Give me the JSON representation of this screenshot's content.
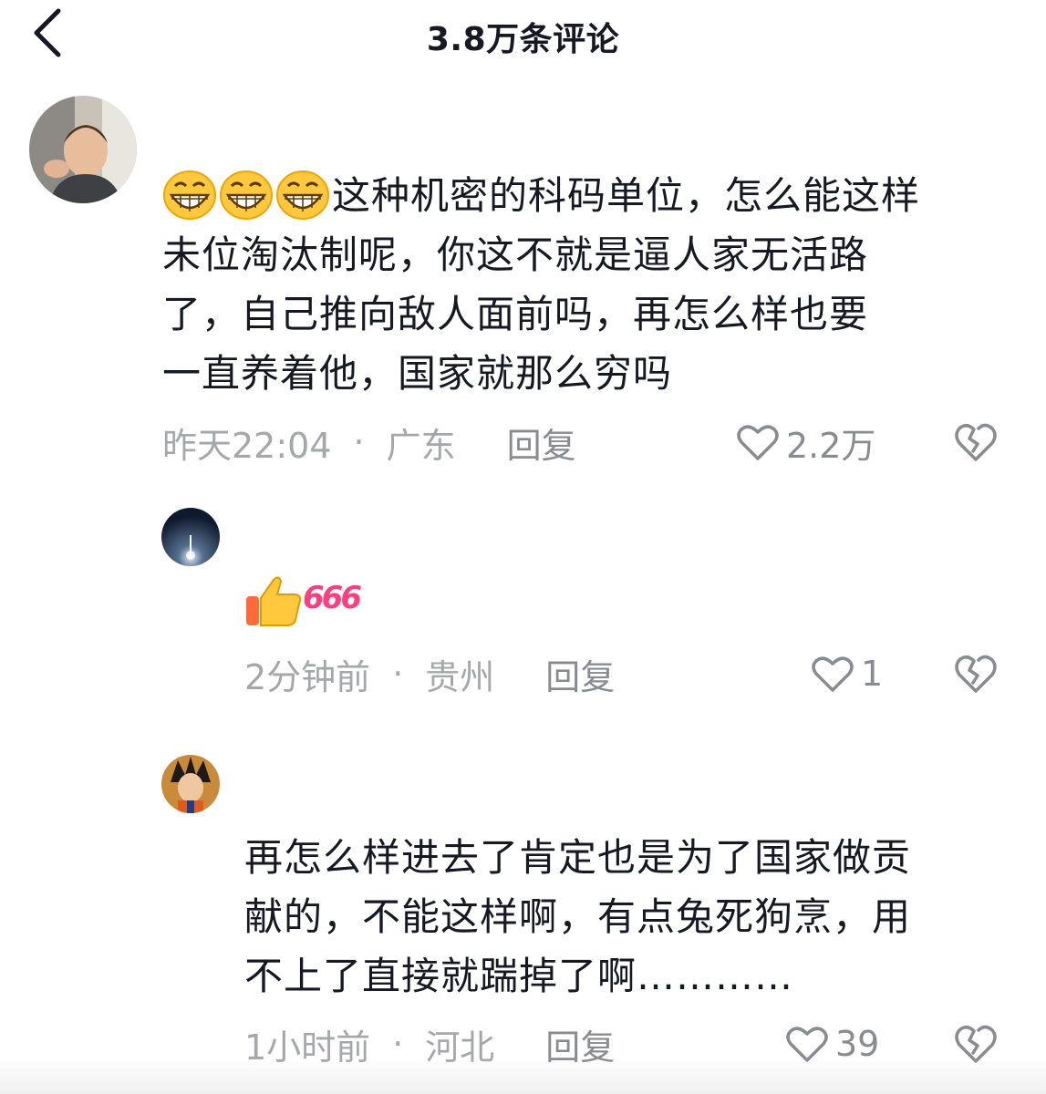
{
  "header": {
    "title": "3.8万条评论"
  },
  "comments": [
    {
      "text_lines": [
        "这种机密的科码单位，怎么能这样",
        "未位淘汰制呢，你这不就是逼人家无活路",
        "了，自己推向敌人面前吗，再怎么样也要",
        "一直养着他，国家就那么穷吗"
      ],
      "time": "昨天22:04",
      "dot": "·",
      "location": "广东",
      "reply_label": "回复",
      "likes": "2.2万"
    },
    {
      "sticker_text": "666",
      "time": "2分钟前",
      "dot": "·",
      "location": "贵州",
      "reply_label": "回复",
      "likes": "1"
    },
    {
      "text_lines": [
        "再怎么样进去了肯定也是为了国家做贡",
        "献的，不能这样啊，有点兔死狗烹，用",
        "不上了直接就踹掉了啊…………"
      ],
      "time": "1小时前",
      "dot": "·",
      "location": "河北",
      "reply_label": "回复",
      "likes": "39"
    }
  ],
  "colors": {
    "meta_gray": "#a6a7ab",
    "text": "#161823",
    "emoji_yellow": "#ffc83d",
    "sticker_pink": "#ff3d7f"
  },
  "icons": [
    "back-chevron-icon",
    "grin-emoji-icon",
    "heart-outline-icon",
    "broken-heart-icon",
    "thumbs-up-sticker-icon"
  ]
}
